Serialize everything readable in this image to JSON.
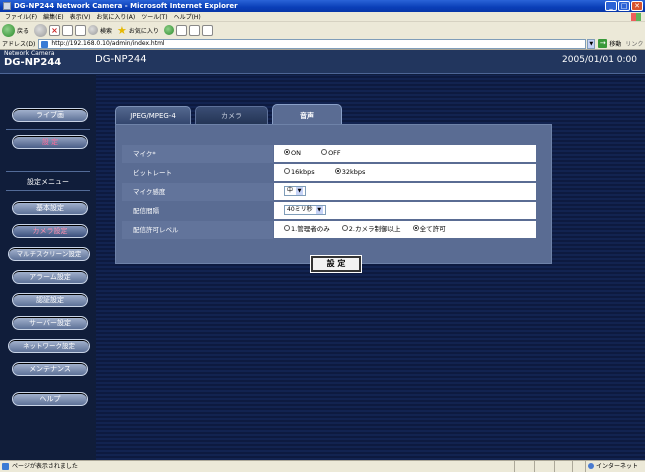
{
  "window": {
    "title": "DG-NP244 Network Camera - Microsoft Internet Explorer",
    "buttons": {
      "minimize": "_",
      "maximize": "□",
      "close": "✕"
    }
  },
  "menubar": [
    "ファイル(F)",
    "編集(E)",
    "表示(V)",
    "お気に入り(A)",
    "ツール(T)",
    "ヘルプ(H)"
  ],
  "toolbar": {
    "back_label": "戻る",
    "search_label": "検索",
    "favorites_label": "お気に入り"
  },
  "address": {
    "label": "アドレス(D)",
    "url": "http://192.168.0.10/admin/index.html",
    "go_label": "移動",
    "links_label": "リンク"
  },
  "header": {
    "brand_small": "Network Camera",
    "brand_large": "DG-NP244",
    "title": "DG-NP244",
    "datetime": "2005/01/01  0:00"
  },
  "sidebar": {
    "live": "ライブ画",
    "setting": "設 定",
    "menu_label": "設定メニュー",
    "items": [
      "基本設定",
      "カメラ設定",
      "マルチスクリーン設定",
      "アラーム設定",
      "認証設定",
      "サーバー設定",
      "ネットワーク設定",
      "メンテナンス",
      "ヘルプ"
    ]
  },
  "tabs": [
    "JPEG/MPEG-4",
    "カメラ",
    "音声"
  ],
  "form": {
    "rows": [
      {
        "label": "マイク*",
        "options": [
          "ON",
          "OFF"
        ],
        "selected": 0
      },
      {
        "label": "ビットレート",
        "options": [
          "16kbps",
          "32kbps"
        ],
        "selected": 1
      },
      {
        "label": "マイク感度",
        "select": "中"
      },
      {
        "label": "配信間隔",
        "select": "40ミリ秒"
      },
      {
        "label": "配信許可レベル",
        "options": [
          "1.管理者のみ",
          "2.カメラ制御以上",
          "全て許可"
        ],
        "selected": 2
      }
    ],
    "submit_label": "設 定"
  },
  "statusbar": {
    "text": "ページが表示されました",
    "zone": "インターネット"
  },
  "colors": {
    "content_bg": "#0f1d3d",
    "panel_bg": "#5a6c93",
    "accent_pink": "#ff8fb0"
  }
}
